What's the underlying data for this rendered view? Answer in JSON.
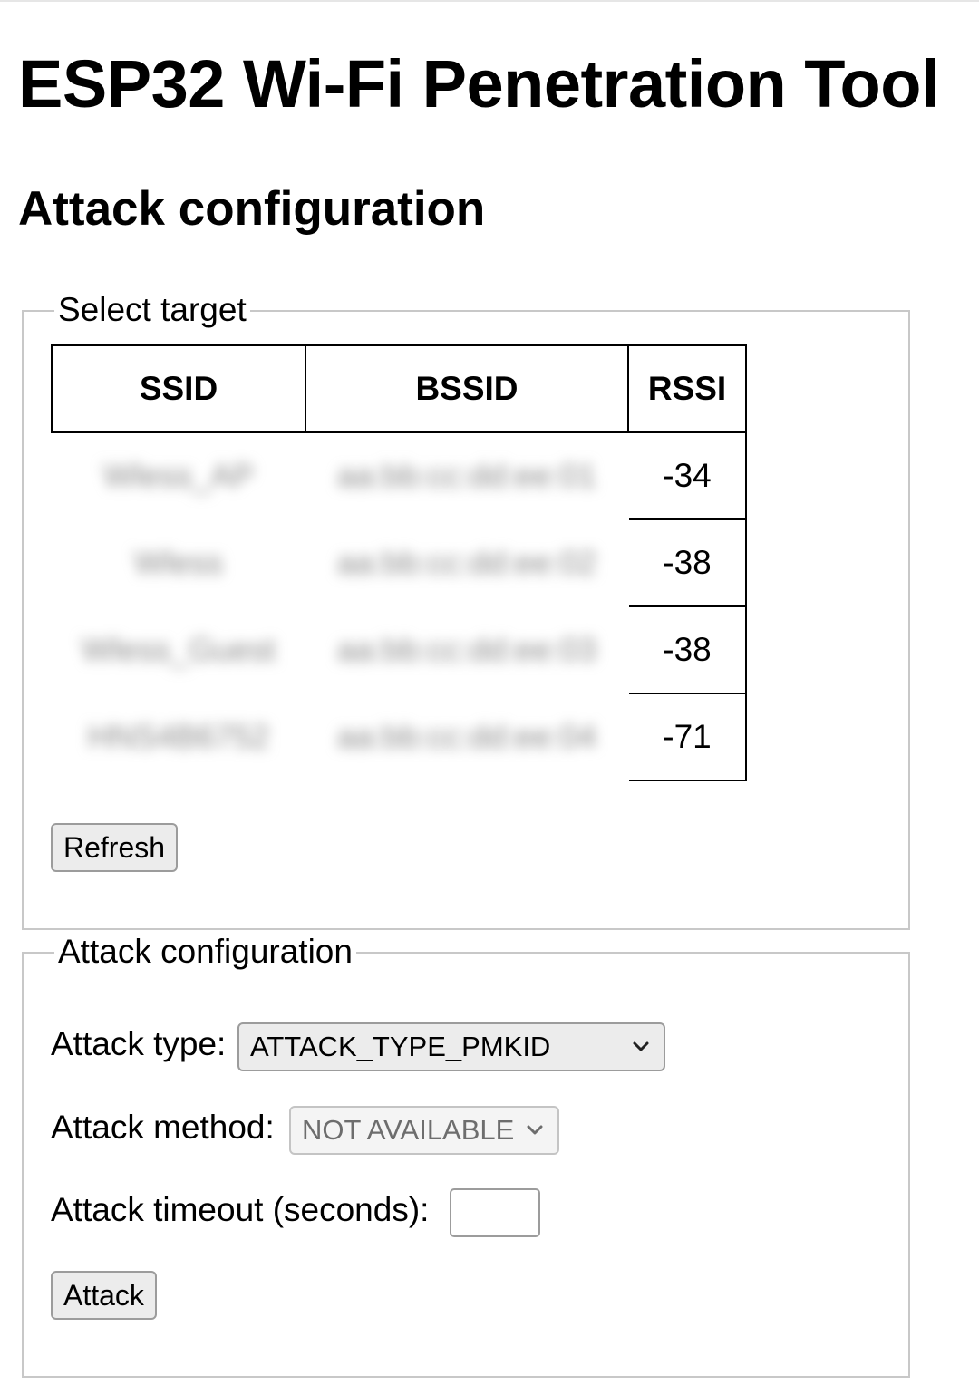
{
  "page": {
    "title": "ESP32 Wi-Fi Penetration Tool",
    "section_title": "Attack configuration"
  },
  "target_panel": {
    "legend": "Select target",
    "columns": [
      "SSID",
      "BSSID",
      "RSSI"
    ],
    "rows": [
      {
        "ssid": "Wless_AP",
        "bssid": "aa:bb:cc:dd:ee:01",
        "rssi": "-34"
      },
      {
        "ssid": "Wless",
        "bssid": "aa:bb:cc:dd:ee:02",
        "rssi": "-38"
      },
      {
        "ssid": "Wless_Guest",
        "bssid": "aa:bb:cc:dd:ee:03",
        "rssi": "-38"
      },
      {
        "ssid": "HNS4B6752",
        "bssid": "aa:bb:cc:dd:ee:04",
        "rssi": "-71"
      }
    ],
    "refresh_label": "Refresh"
  },
  "attack_panel": {
    "legend": "Attack configuration",
    "type_label": "Attack type:",
    "type_value": "ATTACK_TYPE_PMKID",
    "method_label": "Attack method:",
    "method_value": "NOT AVAILABLE",
    "timeout_label": "Attack timeout (seconds):",
    "timeout_value": "",
    "attack_label": "Attack"
  },
  "icons": {
    "dropdown": "chevron-down-icon"
  }
}
